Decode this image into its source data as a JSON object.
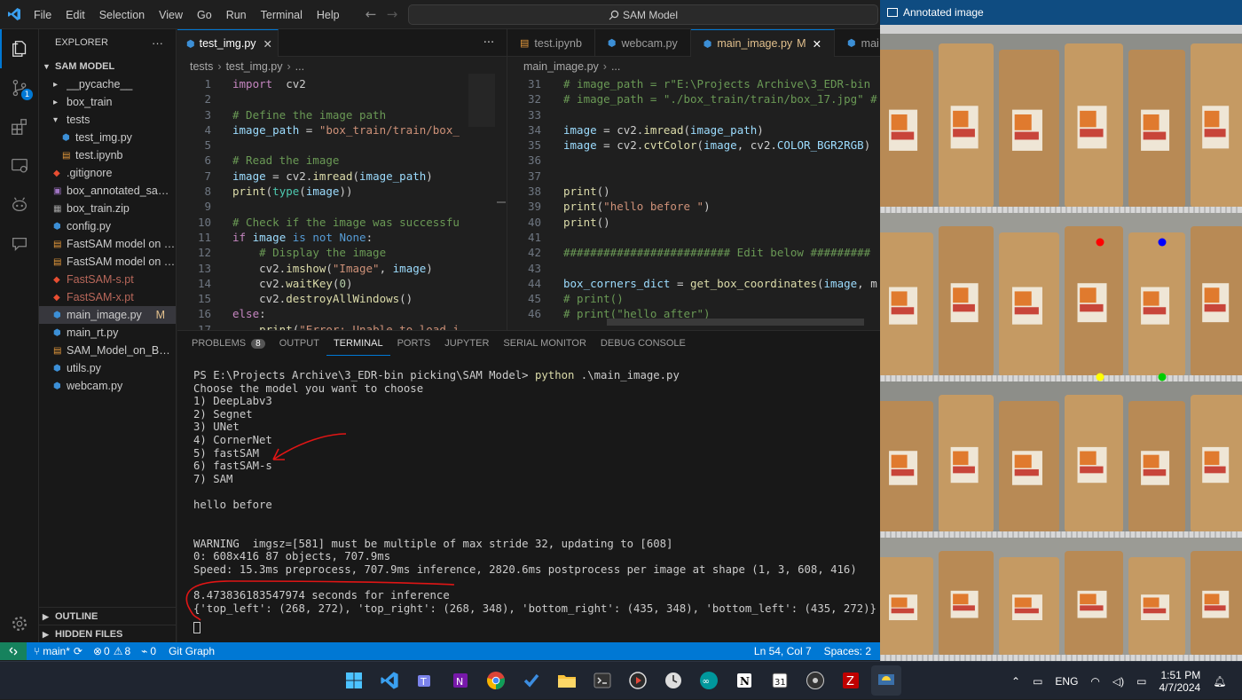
{
  "titlebar": {
    "menu": [
      "File",
      "Edit",
      "Selection",
      "View",
      "Go",
      "Run",
      "Terminal",
      "Help"
    ],
    "search": "SAM Model"
  },
  "activity": {
    "scm_badge": "1"
  },
  "explorer": {
    "header": "EXPLORER",
    "root": "SAM MODEL",
    "items": [
      {
        "label": "__pycache__",
        "type": "folder",
        "indent": 1
      },
      {
        "label": "box_train",
        "type": "folder",
        "indent": 1
      },
      {
        "label": "tests",
        "type": "folder-open",
        "indent": 1
      },
      {
        "label": "test_img.py",
        "type": "py",
        "indent": 2
      },
      {
        "label": "test.ipynb",
        "type": "ipynb",
        "indent": 2
      },
      {
        "label": ".gitignore",
        "type": "git",
        "indent": 1
      },
      {
        "label": "box_annotated_sampl...",
        "type": "img",
        "indent": 1
      },
      {
        "label": "box_train.zip",
        "type": "zip",
        "indent": 1
      },
      {
        "label": "config.py",
        "type": "py",
        "indent": 1
      },
      {
        "label": "FastSAM model on b...",
        "type": "ipynb",
        "indent": 1
      },
      {
        "label": "FastSAM model on b...",
        "type": "ipynb",
        "indent": 1
      },
      {
        "label": "FastSAM-s.pt",
        "type": "pt",
        "indent": 1
      },
      {
        "label": "FastSAM-x.pt",
        "type": "pt",
        "indent": 1
      },
      {
        "label": "main_image.py",
        "type": "py",
        "indent": 1,
        "badge": "M",
        "selected": true
      },
      {
        "label": "main_rt.py",
        "type": "py",
        "indent": 1
      },
      {
        "label": "SAM_Model_on_Box_I...",
        "type": "ipynb",
        "indent": 1
      },
      {
        "label": "utils.py",
        "type": "py",
        "indent": 1
      },
      {
        "label": "webcam.py",
        "type": "py",
        "indent": 1
      }
    ],
    "outline": "OUTLINE",
    "hidden": "HIDDEN FILES"
  },
  "left_editor": {
    "tab": "test_img.py",
    "crumbs": [
      "tests",
      "test_img.py",
      "..."
    ],
    "lines": [
      {
        "n": "1",
        "t": [
          [
            "kw2",
            "import"
          ],
          [
            "",
            "  cv2"
          ]
        ]
      },
      {
        "n": "2",
        "t": []
      },
      {
        "n": "3",
        "t": [
          [
            "cm",
            "# Define the image path"
          ]
        ]
      },
      {
        "n": "4",
        "t": [
          [
            "var",
            "image_path"
          ],
          [
            "",
            " = "
          ],
          [
            "str",
            "\"box_train/train/box_"
          ]
        ]
      },
      {
        "n": "5",
        "t": []
      },
      {
        "n": "6",
        "t": [
          [
            "cm",
            "# Read the image"
          ]
        ]
      },
      {
        "n": "7",
        "t": [
          [
            "var",
            "image"
          ],
          [
            "",
            " = cv2."
          ],
          [
            "fn",
            "imread"
          ],
          [
            "",
            "("
          ],
          [
            "var",
            "image_path"
          ],
          [
            "",
            ")"
          ]
        ]
      },
      {
        "n": "8",
        "t": [
          [
            "fn",
            "print"
          ],
          [
            "",
            "("
          ],
          [
            "cls",
            "type"
          ],
          [
            "",
            "("
          ],
          [
            "var",
            "image"
          ],
          [
            "",
            "))"
          ]
        ]
      },
      {
        "n": "9",
        "t": []
      },
      {
        "n": "10",
        "t": [
          [
            "cm",
            "# Check if the image was successfu"
          ]
        ]
      },
      {
        "n": "11",
        "t": [
          [
            "kw2",
            "if"
          ],
          [
            "",
            " "
          ],
          [
            "var",
            "image"
          ],
          [
            "",
            " "
          ],
          [
            "kw",
            "is not None"
          ],
          [
            "",
            ":"
          ]
        ]
      },
      {
        "n": "12",
        "t": [
          [
            "",
            "    "
          ],
          [
            "cm",
            "# Display the image"
          ]
        ]
      },
      {
        "n": "13",
        "t": [
          [
            "",
            "    cv2."
          ],
          [
            "fn",
            "imshow"
          ],
          [
            "",
            "("
          ],
          [
            "str",
            "\"Image\""
          ],
          [
            "",
            ", "
          ],
          [
            "var",
            "image"
          ],
          [
            "",
            ")"
          ]
        ]
      },
      {
        "n": "14",
        "t": [
          [
            "",
            "    cv2."
          ],
          [
            "fn",
            "waitKey"
          ],
          [
            "",
            "("
          ],
          [
            "num",
            "0"
          ],
          [
            "",
            ")"
          ]
        ]
      },
      {
        "n": "15",
        "t": [
          [
            "",
            "    cv2."
          ],
          [
            "fn",
            "destroyAllWindows"
          ],
          [
            "",
            "()"
          ]
        ]
      },
      {
        "n": "16",
        "t": [
          [
            "kw2",
            "else"
          ],
          [
            "",
            ":"
          ]
        ]
      },
      {
        "n": "17",
        "t": [
          [
            "",
            "    "
          ],
          [
            "fn",
            "print"
          ],
          [
            "",
            "("
          ],
          [
            "str",
            "\"Error: Unable to load i"
          ]
        ]
      }
    ]
  },
  "right_editor": {
    "tabs": [
      {
        "label": "test.ipynb",
        "active": false
      },
      {
        "label": "webcam.py",
        "active": false
      },
      {
        "label": "main_image.py",
        "active": true,
        "badge": "M"
      },
      {
        "label": "mai",
        "active": false
      }
    ],
    "crumbs": [
      "main_image.py",
      "..."
    ],
    "lines": [
      {
        "n": "31",
        "t": [
          [
            "cm",
            "# image_path = r\"E:\\Projects Archive\\3_EDR-bin"
          ]
        ]
      },
      {
        "n": "32",
        "t": [
          [
            "cm",
            "# image_path = \"./box_train/train/box_17.jpg\" #"
          ]
        ]
      },
      {
        "n": "33",
        "t": []
      },
      {
        "n": "34",
        "t": [
          [
            "var",
            "image"
          ],
          [
            "",
            " = cv2."
          ],
          [
            "fn",
            "imread"
          ],
          [
            "",
            "("
          ],
          [
            "var",
            "image_path"
          ],
          [
            "",
            ")"
          ]
        ]
      },
      {
        "n": "35",
        "t": [
          [
            "var",
            "image"
          ],
          [
            "",
            " = cv2."
          ],
          [
            "fn",
            "cvtColor"
          ],
          [
            "",
            "("
          ],
          [
            "var",
            "image"
          ],
          [
            "",
            ", cv2."
          ],
          [
            "var",
            "COLOR_BGR2RGB"
          ],
          [
            "",
            ")"
          ]
        ]
      },
      {
        "n": "36",
        "t": []
      },
      {
        "n": "37",
        "t": []
      },
      {
        "n": "38",
        "t": [
          [
            "fn",
            "print"
          ],
          [
            "",
            "()"
          ]
        ]
      },
      {
        "n": "39",
        "t": [
          [
            "fn",
            "print"
          ],
          [
            "",
            "("
          ],
          [
            "str",
            "\"hello before \""
          ],
          [
            "",
            ")"
          ]
        ]
      },
      {
        "n": "40",
        "t": [
          [
            "fn",
            "print"
          ],
          [
            "",
            "()"
          ]
        ]
      },
      {
        "n": "41",
        "t": []
      },
      {
        "n": "42",
        "t": [
          [
            "cm",
            "######################### Edit below #########"
          ]
        ]
      },
      {
        "n": "43",
        "t": []
      },
      {
        "n": "44",
        "t": [
          [
            "var",
            "box_corners_dict"
          ],
          [
            "",
            " = "
          ],
          [
            "fn",
            "get_box_coordinates"
          ],
          [
            "",
            "("
          ],
          [
            "var",
            "image"
          ],
          [
            "",
            ", m"
          ]
        ]
      },
      {
        "n": "45",
        "t": [
          [
            "cm",
            "# print()"
          ]
        ]
      },
      {
        "n": "46",
        "t": [
          [
            "cm",
            "# print(\"hello after\")"
          ]
        ]
      }
    ]
  },
  "panel": {
    "tabs": [
      "PROBLEMS",
      "OUTPUT",
      "TERMINAL",
      "PORTS",
      "JUPYTER",
      "SERIAL MONITOR",
      "DEBUG CONSOLE"
    ],
    "problems_count": "8",
    "active": "TERMINAL",
    "prompt": "PS E:\\Projects Archive\\3_EDR-bin picking\\SAM Model> ",
    "command": "python",
    "command_arg": " .\\main_image.py",
    "output": [
      "Choose the model you want to choose",
      "1) DeepLabv3",
      "2) Segnet",
      "3) UNet",
      "4) CornerNet",
      "5) fastSAM",
      "6) fastSAM-s",
      "7) SAM",
      "",
      "hello before",
      "",
      "",
      "WARNING  imgsz=[581] must be multiple of max stride 32, updating to [608]",
      "0: 608x416 87 objects, 707.9ms",
      "Speed: 15.3ms preprocess, 707.9ms inference, 2820.6ms postprocess per image at shape (1, 3, 608, 416)",
      "",
      "8.473836183547974 seconds for inference",
      "{'top_left': (268, 272), 'top_right': (268, 348), 'bottom_right': (435, 348), 'bottom_left': (435, 272)}"
    ]
  },
  "status": {
    "branch": "main*",
    "errors": "0",
    "warnings": "8",
    "ports": "0",
    "gitgraph": "Git Graph",
    "position": "Ln 54, Col 7",
    "spaces": "Spaces: 2"
  },
  "image_window": {
    "title": "Annotated image",
    "markers": [
      {
        "name": "top-left-marker",
        "color": "#ff0000"
      },
      {
        "name": "top-right-marker",
        "color": "#0000ff"
      },
      {
        "name": "bottom-left-marker",
        "color": "#ffff00"
      },
      {
        "name": "bottom-right-marker",
        "color": "#00cc00"
      }
    ]
  },
  "taskbar": {
    "lang": "ENG",
    "time": "1:51 PM",
    "date": "4/7/2024"
  }
}
